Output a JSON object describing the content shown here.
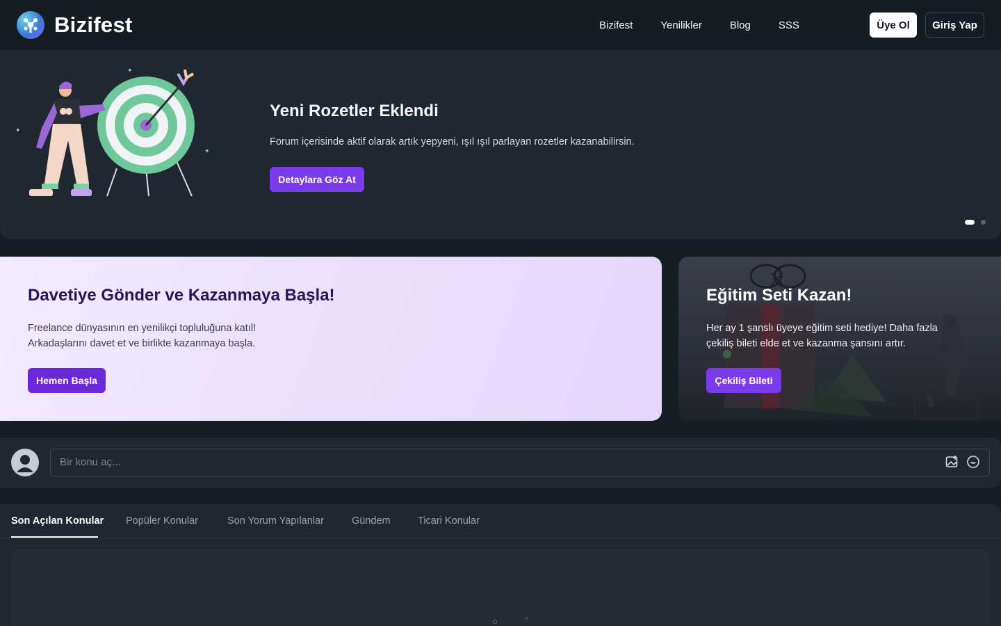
{
  "brand": {
    "name": "Bizifest"
  },
  "nav": {
    "links": [
      "Bizifest",
      "Yenilikler",
      "Blog",
      "SSS"
    ],
    "signup_label": "Üye Ol",
    "login_label": "Giriş Yap"
  },
  "hero": {
    "title": "Yeni Rozetler Eklendi",
    "description": "Forum içerisinde aktif olarak artık yepyeni, ışıl ışıl parlayan rozetler kazanabilirsin.",
    "button_label": "Detaylara Göz At",
    "slide_count": 2,
    "active_slide": 1
  },
  "invite_card": {
    "title": "Davetiye Gönder ve Kazanmaya Başla!",
    "description_line1": "Freelance dünyasının en yenilikçi topluluğuna katıl!",
    "description_line2": "Arkadaşlarını davet et ve birlikte kazanmaya başla.",
    "button_label": "Hemen Başla"
  },
  "edu_card": {
    "title": "Eğitim Seti Kazan!",
    "description": "Her ay 1 şanslı üyeye eğitim seti hediye! Daha fazla çekiliş bileti elde et ve kazanma şansını artır.",
    "button_label": "Çekiliş Bileti"
  },
  "composer": {
    "placeholder": "Bir konu aç..."
  },
  "tabs": [
    {
      "label": "Son Açılan Konular",
      "active": true
    },
    {
      "label": "Popüler Konular",
      "active": false
    },
    {
      "label": "Son Yorum Yapılanlar",
      "active": false
    },
    {
      "label": "Gündem",
      "active": false
    },
    {
      "label": "Ticari Konular",
      "active": false
    }
  ],
  "colors": {
    "background": "#171d25",
    "panel": "#1f2731",
    "accent": "#7c3aed",
    "invite_gradient_start": "#f3ebfe",
    "invite_title": "#2a1459"
  },
  "icons": [
    "logo-mark-icon",
    "target-illustration",
    "image-upload-icon",
    "emoji-icon",
    "user-avatar-icon"
  ]
}
